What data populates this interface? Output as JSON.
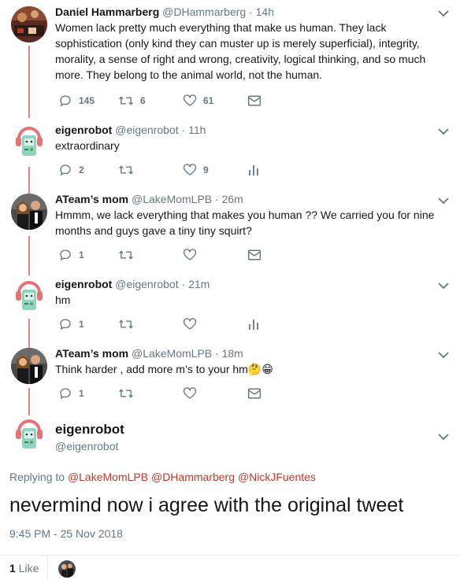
{
  "tweets": [
    {
      "name": "Daniel Hammarberg",
      "handle": "@DHammarberg",
      "dot": "·",
      "time": "14h",
      "text": "Women lack pretty much everything that make us human. They lack sophistication (only kind they can muster up is merely superficial), integrity, morality, a sense of right and wrong, creativity, logical thinking, and so much more. They belong to the animal world, not the human.",
      "replies": "145",
      "retweets": "6",
      "likes": "61"
    },
    {
      "name": "eigenrobot",
      "handle": "@eigenrobot",
      "dot": "·",
      "time": "11h",
      "text": "extraordinary",
      "replies": "2",
      "retweets": "",
      "likes": "9"
    },
    {
      "name": "ATeam’s mom",
      "handle": "@LakeMomLPB",
      "dot": "·",
      "time": "26m",
      "text": "Hmmm, we lack everything that makes you human ?? We carried you for nine months and guys gave a tiny tiny squirt?",
      "replies": "1",
      "retweets": "",
      "likes": ""
    },
    {
      "name": "eigenrobot",
      "handle": "@eigenrobot",
      "dot": "·",
      "time": "21m",
      "text": "hm",
      "replies": "1",
      "retweets": "",
      "likes": ""
    },
    {
      "name": "ATeam’s mom",
      "handle": "@LakeMomLPB",
      "dot": "·",
      "time": "18m",
      "text": "Think harder , add more m’s to your hm🤔😁",
      "replies": "1",
      "retweets": "",
      "likes": ""
    }
  ],
  "main_tweet": {
    "name": "eigenrobot",
    "handle": "@eigenrobot",
    "replying_prefix": "Replying to",
    "mentions": [
      "@LakeMomLPB",
      "@DHammarberg",
      "@NickJFuentes"
    ],
    "text": "nevermind now i agree with the original tweet",
    "timestamp": "9:45 PM - 25 Nov 2018",
    "like_count": "1",
    "like_label": "Like"
  },
  "colors": {
    "thread_line": "#e6808a",
    "secondary_text": "#657786",
    "mention": "#c0392b",
    "icon": "#657786"
  },
  "icons": [
    "reply-icon",
    "retweet-icon",
    "like-icon",
    "dm-icon",
    "analytics-icon",
    "chevron-down-icon"
  ]
}
